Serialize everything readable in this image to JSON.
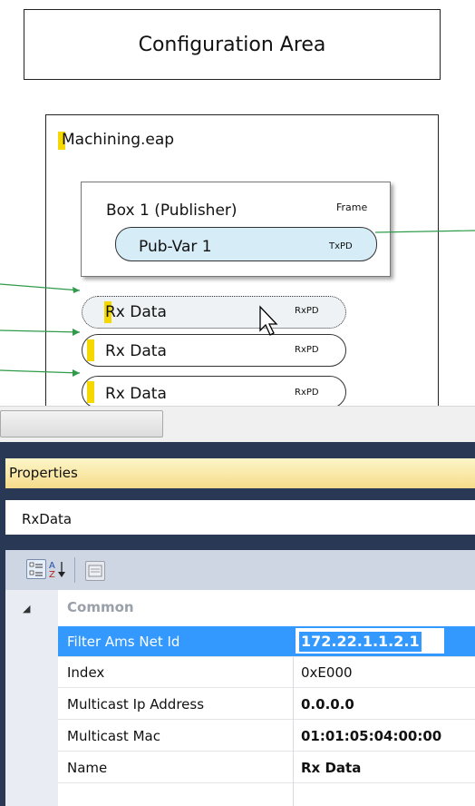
{
  "diagram": {
    "config_area": "Configuration Area",
    "machining_title": "Machining.eap",
    "box1_title": "Box 1 (Publisher)",
    "frame_label": "Frame",
    "pubvar_label": "Pub-Var 1",
    "pubvar_tag": "TxPD",
    "rx_items": [
      {
        "label": "Rx Data",
        "tag": "RxPD"
      },
      {
        "label": "Rx Data",
        "tag": "RxPD"
      },
      {
        "label": "Rx Data",
        "tag": "RxPD"
      }
    ]
  },
  "properties": {
    "title": "Properties",
    "object_name": "RxData",
    "toolbar": {
      "categorized_icon": "categorized-icon",
      "alphabetical_icon": "sort-az-icon",
      "property_pages_icon": "property-pages-icon"
    },
    "category": "Common",
    "rows": [
      {
        "name": "Filter Ams Net Id",
        "value": "172.22.1.1.2.1"
      },
      {
        "name": "Index",
        "value": "0xE000"
      },
      {
        "name": "Multicast Ip Address",
        "value": "0.0.0.0"
      },
      {
        "name": "Multicast Mac",
        "value": "01:01:05:04:00:00"
      },
      {
        "name": "Name",
        "value": "Rx Data"
      }
    ]
  },
  "colors": {
    "selection": "#3399ff",
    "panel_frame": "#293955",
    "title_bar": "#f6dc8b",
    "pubvar_fill": "#d6ecf6",
    "marker_yellow": "#f5d800"
  }
}
